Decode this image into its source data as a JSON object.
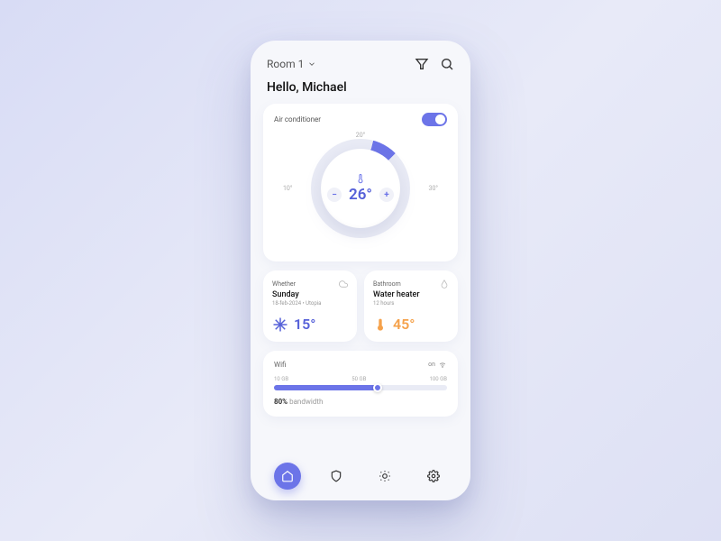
{
  "header": {
    "room": "Room 1",
    "greeting": "Hello, Michael"
  },
  "ac": {
    "label": "Air conditioner",
    "scale_top": "20°",
    "scale_left": "10°",
    "scale_right": "30°",
    "temperature": "26°",
    "minus": "−",
    "plus": "+"
  },
  "weather": {
    "title": "Whether",
    "day": "Sunday",
    "date": "18-feb-2024 • Utopia",
    "temp": "15°"
  },
  "bathroom": {
    "title": "Bathroom",
    "device": "Water heater",
    "duration": "12 hours",
    "temp": "45°"
  },
  "wifi": {
    "title": "Wifi",
    "status": "on",
    "scale_low": "10 GB",
    "scale_mid": "50 GB",
    "scale_high": "100 GB",
    "bandwidth_pct": "80%",
    "bandwidth_label": "bandwidth"
  }
}
